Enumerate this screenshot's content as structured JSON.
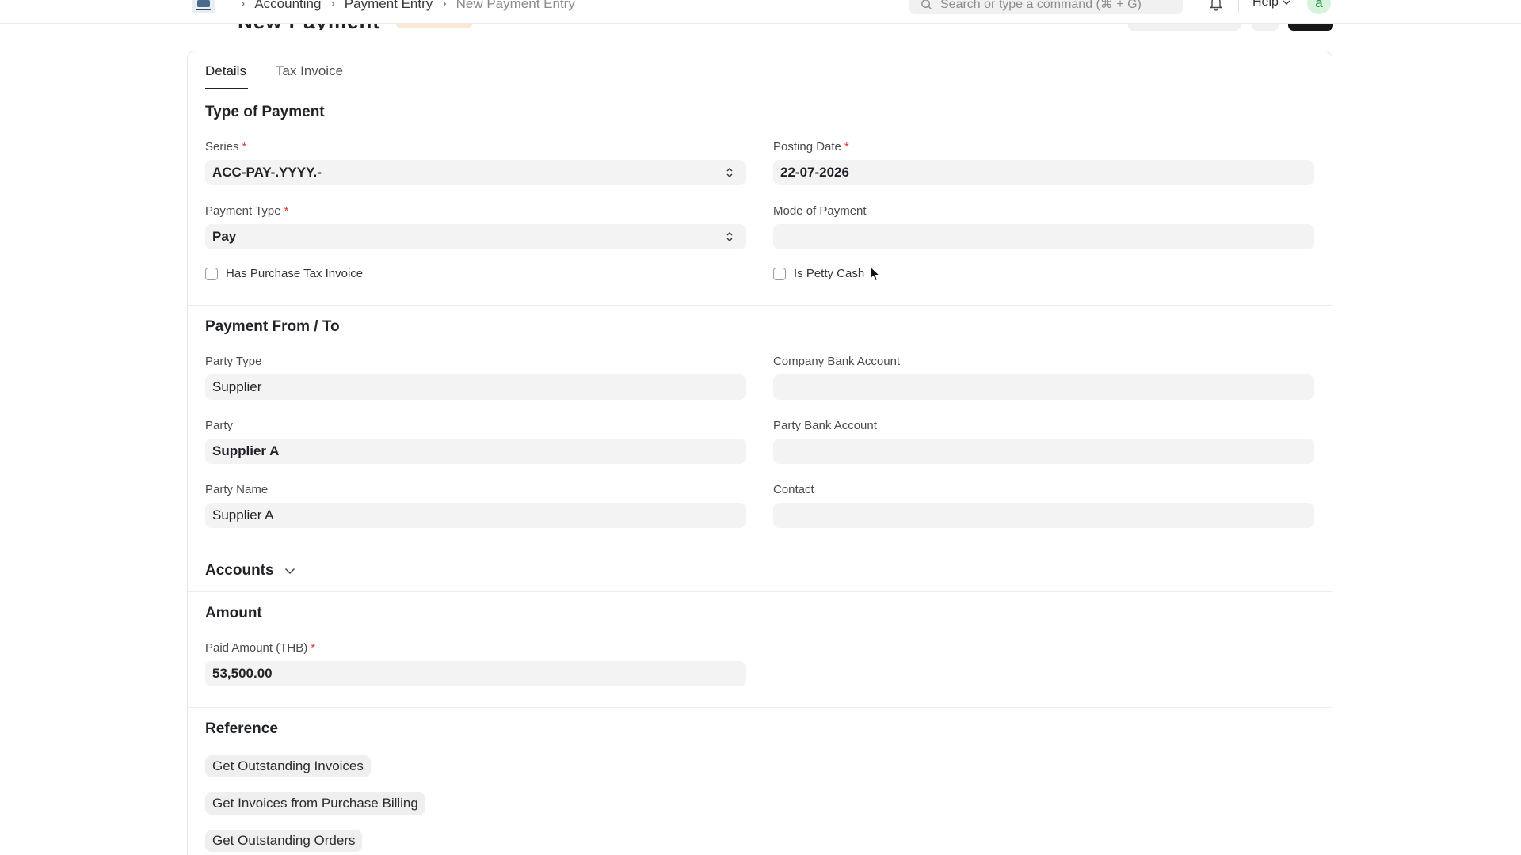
{
  "navbar": {
    "breadcrumbs": [
      "Accounting",
      "Payment Entry",
      "New Payment Entry"
    ],
    "search_placeholder": "Search or type a command (⌘ + G)",
    "help_label": "Help",
    "avatar_initial": "a"
  },
  "tabs": [
    "Details",
    "Tax Invoice"
  ],
  "sections": {
    "type_of_payment": {
      "title": "Type of Payment",
      "series": {
        "label": "Series",
        "value": "ACC-PAY-.YYYY.-"
      },
      "posting_date": {
        "label": "Posting Date",
        "value": "22-07-2026"
      },
      "payment_type": {
        "label": "Payment Type",
        "value": "Pay"
      },
      "mode_of_payment": {
        "label": "Mode of Payment",
        "value": ""
      },
      "has_purchase_tax_invoice": {
        "label": "Has Purchase Tax Invoice",
        "checked": false
      },
      "is_petty_cash": {
        "label": "Is Petty Cash",
        "checked": false
      }
    },
    "payment_from_to": {
      "title": "Payment From / To",
      "party_type": {
        "label": "Party Type",
        "value": "Supplier"
      },
      "company_bank_account": {
        "label": "Company Bank Account",
        "value": ""
      },
      "party": {
        "label": "Party",
        "value": "Supplier A"
      },
      "party_bank_account": {
        "label": "Party Bank Account",
        "value": ""
      },
      "party_name": {
        "label": "Party Name",
        "value": "Supplier A"
      },
      "contact": {
        "label": "Contact",
        "value": ""
      }
    },
    "accounts": {
      "title": "Accounts"
    },
    "amount": {
      "title": "Amount",
      "paid_amount": {
        "label": "Paid Amount (THB)",
        "value": "53,500.00"
      }
    },
    "reference": {
      "title": "Reference",
      "buttons": [
        "Get Outstanding Invoices",
        "Get Invoices from Purchase Billing",
        "Get Outstanding Orders"
      ]
    }
  },
  "required_marker": "*",
  "colors": {
    "accent": "#1f2328",
    "required": "#e03636",
    "field_bg": "#f3f3f3",
    "primary_button": "#171717"
  }
}
